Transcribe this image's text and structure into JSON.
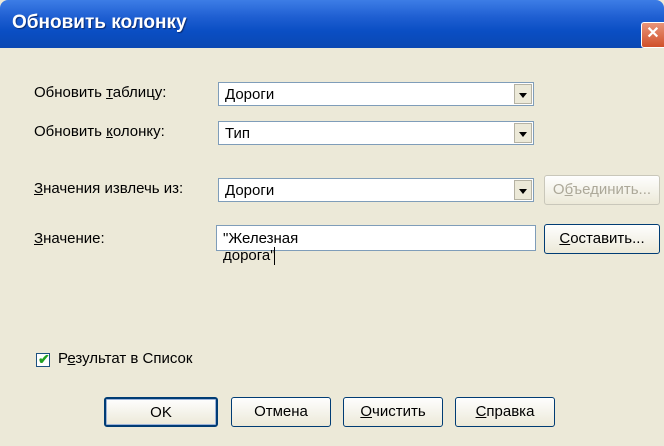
{
  "window": {
    "title": "Обновить колонку",
    "close": "✕"
  },
  "fields": {
    "update_table": {
      "label_pre": "Обновить ",
      "label_u": "т",
      "label_post": "аблицу:",
      "value": "Дороги"
    },
    "update_column": {
      "label_pre": "Обновить ",
      "label_u": "к",
      "label_post": "олонку:",
      "value": "Тип"
    },
    "values_from": {
      "label_pre": "",
      "label_u": "З",
      "label_post": "начения извлечь из:",
      "value": "Дороги"
    },
    "value": {
      "label_pre": "",
      "label_u": "З",
      "label_post": "начение:",
      "value": "\"Железная дорога\""
    }
  },
  "buttons": {
    "join": {
      "pre": "О",
      "u": "б",
      "post": "ъединить..."
    },
    "compose": {
      "pre": "",
      "u": "С",
      "post": "оставить..."
    },
    "ok": "OK",
    "cancel": "Отмена",
    "clear": {
      "pre": "",
      "u": "О",
      "post": "чистить"
    },
    "help": {
      "pre": "",
      "u": "С",
      "post": "правка"
    }
  },
  "checkbox": {
    "pre": "Р",
    "u": "е",
    "post": "зультат в Список",
    "checked": true,
    "check_glyph": "✔"
  }
}
